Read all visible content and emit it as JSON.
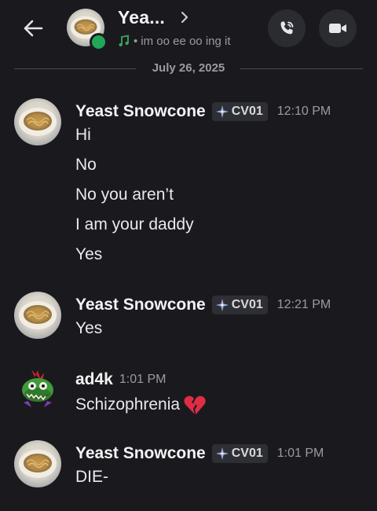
{
  "header": {
    "back_icon": "arrow-left-icon",
    "title": "Yea...",
    "status_text": "im oo ee oo ing it",
    "status_separator": "•",
    "activity_icon": "music-note-icon",
    "online_color": "#23a55a"
  },
  "date_divider": "July 26, 2025",
  "messages": [
    {
      "author": "Yeast Snowcone",
      "tag": "CV01",
      "time": "12:10 PM",
      "lines": [
        "Hi",
        "No",
        "No you aren’t",
        "I am your daddy",
        "Yes"
      ]
    },
    {
      "author": "Yeast Snowcone",
      "tag": "CV01",
      "time": "12:21 PM",
      "lines": [
        "Yes"
      ]
    },
    {
      "author": "ad4k",
      "time": "1:01 PM",
      "lines": [
        "Schizophrenia"
      ],
      "emoji": "broken-heart-icon"
    },
    {
      "author": "Yeast Snowcone",
      "tag": "CV01",
      "time": "1:01 PM",
      "lines": [
        "DIE-"
      ]
    }
  ]
}
